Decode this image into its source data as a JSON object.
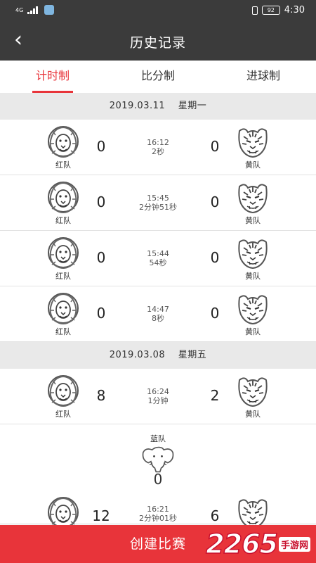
{
  "status_bar": {
    "network": "4G",
    "time": "4:30",
    "battery": "92"
  },
  "nav": {
    "title": "历史记录"
  },
  "tabs": [
    {
      "label": "计时制",
      "active": true
    },
    {
      "label": "比分制",
      "active": false
    },
    {
      "label": "进球制",
      "active": false
    }
  ],
  "groups": [
    {
      "date": "2019.03.11",
      "weekday": "星期一",
      "matches": [
        {
          "home": "红队",
          "home_score": "0",
          "time": "16:12",
          "duration": "2秒",
          "away": "黄队",
          "away_score": "0"
        },
        {
          "home": "红队",
          "home_score": "0",
          "time": "15:45",
          "duration": "2分钟51秒",
          "away": "黄队",
          "away_score": "0"
        },
        {
          "home": "红队",
          "home_score": "0",
          "time": "15:44",
          "duration": "54秒",
          "away": "黄队",
          "away_score": "0"
        },
        {
          "home": "红队",
          "home_score": "0",
          "time": "14:47",
          "duration": "8秒",
          "away": "黄队",
          "away_score": "0"
        }
      ]
    },
    {
      "date": "2019.03.08",
      "weekday": "星期五",
      "matches": [
        {
          "home": "红队",
          "home_score": "8",
          "time": "16:24",
          "duration": "1分钟",
          "away": "黄队",
          "away_score": "2"
        },
        {
          "third_team": "蓝队",
          "third_score": "0",
          "home": "",
          "home_score": "12",
          "time": "16:21",
          "duration": "2分钟01秒",
          "away": "",
          "away_score": "6"
        }
      ]
    }
  ],
  "create_button": "创建比赛",
  "watermark": {
    "number": "2265",
    "site": "手游网"
  },
  "colors": {
    "accent": "#e8343a",
    "header": "#3b3b3b"
  }
}
